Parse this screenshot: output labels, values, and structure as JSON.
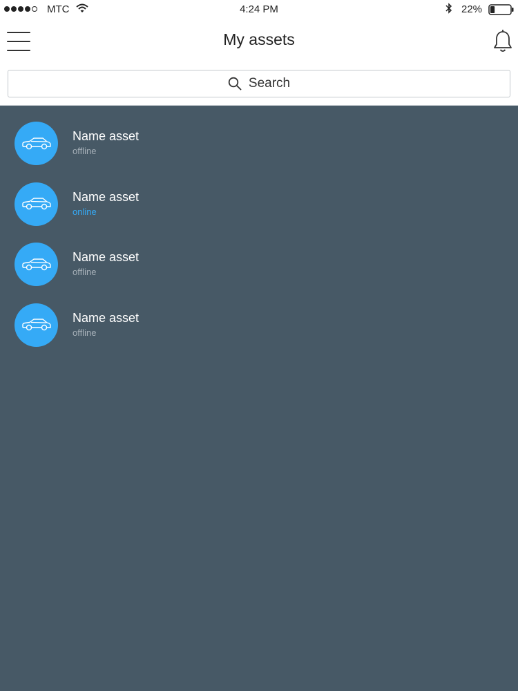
{
  "status_bar": {
    "carrier": "MTC",
    "time": "4:24 PM",
    "battery_percent": "22%",
    "battery_level": 0.22,
    "signal_bars_filled": 4,
    "signal_bars_total": 5
  },
  "header": {
    "title": "My assets"
  },
  "search": {
    "label": "Search"
  },
  "assets": [
    {
      "name": "Name asset",
      "status": "offline"
    },
    {
      "name": "Name asset",
      "status": "online"
    },
    {
      "name": "Name asset",
      "status": "offline"
    },
    {
      "name": "Name asset",
      "status": "offline"
    }
  ],
  "icons": {
    "menu": "hamburger-menu-icon",
    "notifications": "bell-icon",
    "search": "magnifier-icon",
    "asset": "car-icon"
  },
  "colors": {
    "accent": "#35aaf6",
    "background": "#475966",
    "online_status": "#35aaf6",
    "offline_status": "#a6b0b8"
  }
}
